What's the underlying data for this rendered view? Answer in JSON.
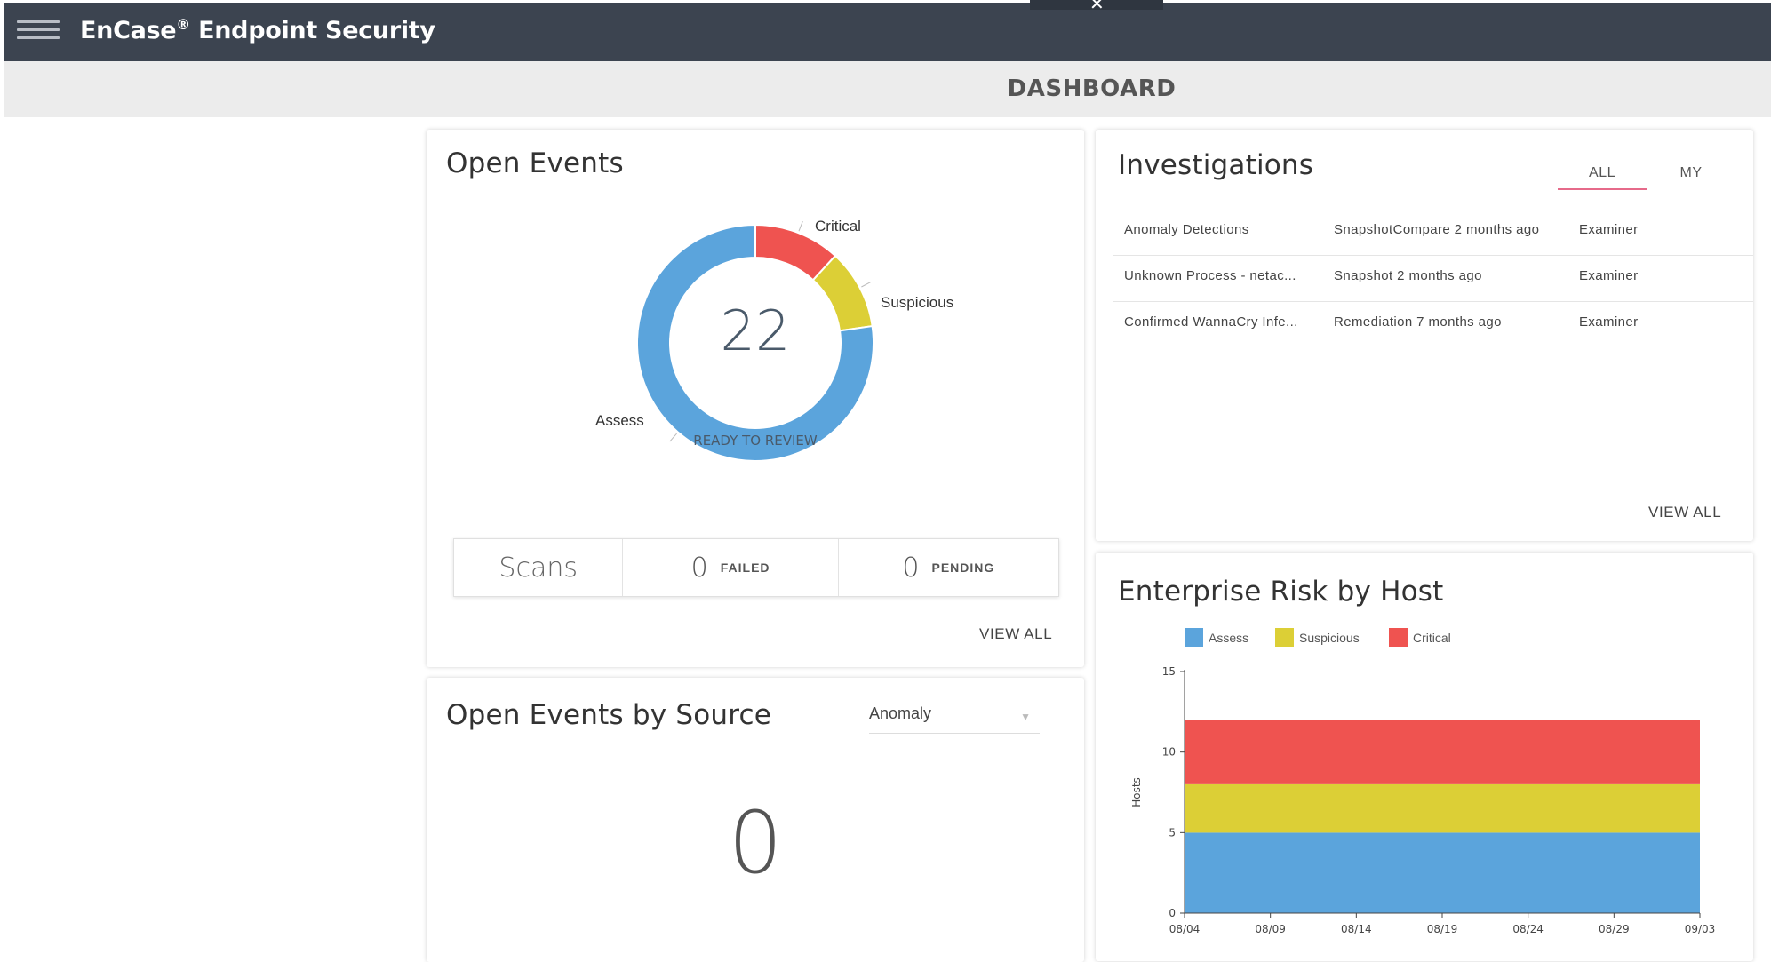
{
  "app": {
    "title": "EnCase",
    "title_mark": "®",
    "title_suffix": " Endpoint Security",
    "close_symbol": "✕"
  },
  "page_title": "DASHBOARD",
  "open_events": {
    "title": "Open Events",
    "total": "22",
    "center_label": "READY TO REVIEW",
    "segments": [
      {
        "name": "Critical",
        "value": 2.6,
        "color": "#ef5350"
      },
      {
        "name": "Suspicious",
        "value": 2.4,
        "color": "#dccf36"
      },
      {
        "name": "Assess",
        "value": 17.0,
        "color": "#5ba4dc"
      }
    ],
    "scans": {
      "label": "Scans",
      "failed_count": "0",
      "failed_label": "FAILED",
      "pending_count": "0",
      "pending_label": "PENDING"
    },
    "view_all": "VIEW ALL"
  },
  "by_source": {
    "title": "Open Events by Source",
    "selected": "Anomaly",
    "count": "0"
  },
  "investigations": {
    "title": "Investigations",
    "tabs": [
      {
        "label": "ALL",
        "active": true
      },
      {
        "label": "MY",
        "active": false
      }
    ],
    "rows": [
      {
        "name": "Anomaly Detections",
        "type": "SnapshotCompare 2 months ago",
        "role": "Examiner"
      },
      {
        "name": "Unknown Process - netac...",
        "type": "Snapshot 2 months ago",
        "role": "Examiner"
      },
      {
        "name": "Confirmed WannaCry Infe...",
        "type": "Remediation 7 months ago",
        "role": "Examiner"
      }
    ],
    "view_all": "VIEW ALL"
  },
  "risk": {
    "title": "Enterprise Risk by Host",
    "legend": [
      "Assess",
      "Suspicious",
      "Critical"
    ],
    "colors": {
      "Assess": "#5ba4dc",
      "Suspicious": "#dccf36",
      "Critical": "#ef5350"
    }
  },
  "chart_data": {
    "type": "area",
    "stacked": true,
    "ylabel": "Hosts",
    "ylim": [
      0,
      15
    ],
    "yticks": [
      0,
      5,
      10,
      15
    ],
    "x": [
      "08/04",
      "08/09",
      "08/14",
      "08/19",
      "08/24",
      "08/29",
      "09/03"
    ],
    "series": [
      {
        "name": "Assess",
        "values": [
          5,
          5,
          5,
          5,
          5,
          5,
          5
        ]
      },
      {
        "name": "Suspicious",
        "values": [
          3,
          3,
          3,
          3,
          3,
          3,
          3
        ]
      },
      {
        "name": "Critical",
        "values": [
          4,
          4,
          4,
          4,
          4,
          4,
          4
        ]
      }
    ],
    "legend_position": "top"
  }
}
